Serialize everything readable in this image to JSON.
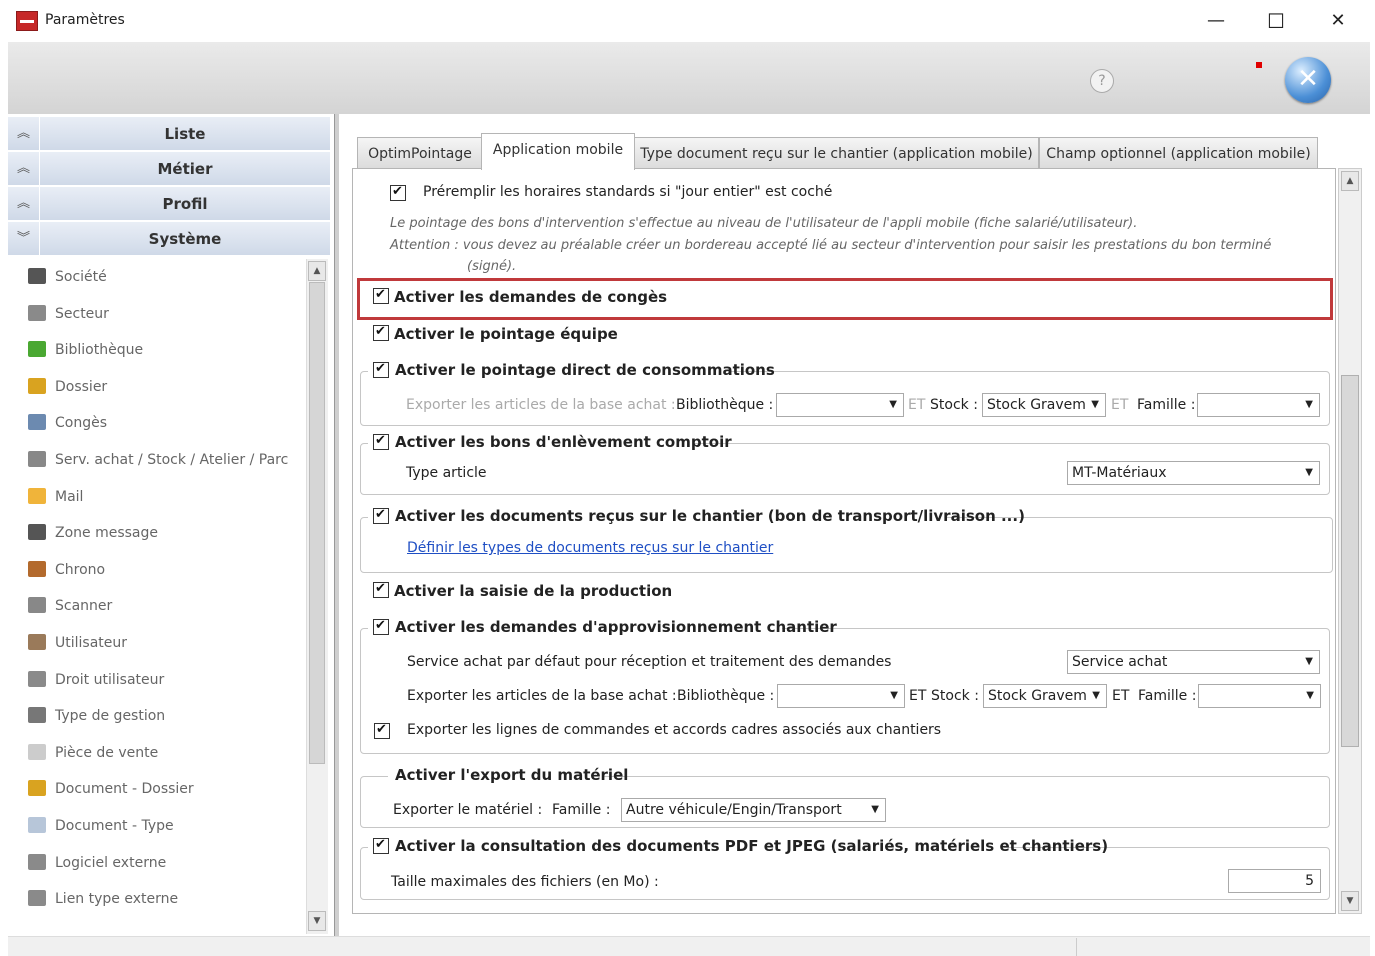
{
  "window": {
    "title": "Paramètres",
    "minimize": "—",
    "maximize": "☐",
    "close": "✕"
  },
  "toolbar": {
    "help_icon": "?",
    "close_icon": "✕"
  },
  "sidebar": {
    "sections": [
      {
        "label": "Liste",
        "chevron": "≈"
      },
      {
        "label": "Métier",
        "chevron": "≈"
      },
      {
        "label": "Profil",
        "chevron": "≈"
      },
      {
        "label": "Système",
        "chevron": "≈"
      }
    ],
    "items": [
      {
        "label": "Société",
        "icon": "building-icon",
        "color": "#555555"
      },
      {
        "label": "Secteur",
        "icon": "sector-icon",
        "color": "#8a8a8a"
      },
      {
        "label": "Bibliothèque",
        "icon": "library-icon",
        "color": "#4aa832"
      },
      {
        "label": "Dossier",
        "icon": "folder-icon",
        "color": "#d9a320"
      },
      {
        "label": "Congès",
        "icon": "calendar-icon",
        "color": "#6c8ab0"
      },
      {
        "label": "Serv. achat / Stock / Atelier / Parc",
        "icon": "truck-icon",
        "color": "#888888"
      },
      {
        "label": "Mail",
        "icon": "mail-icon",
        "color": "#f0b43a"
      },
      {
        "label": "Zone message",
        "icon": "message-icon",
        "color": "#555555"
      },
      {
        "label": "Chrono",
        "icon": "chrono-icon",
        "color": "#b36a2d"
      },
      {
        "label": "Scanner",
        "icon": "scanner-icon",
        "color": "#888888"
      },
      {
        "label": "Utilisateur",
        "icon": "user-icon",
        "color": "#9a7a5a"
      },
      {
        "label": "Droit utilisateur",
        "icon": "lock-icon",
        "color": "#8a8a8a"
      },
      {
        "label": "Type de gestion",
        "icon": "tag-icon",
        "color": "#777777"
      },
      {
        "label": "Pièce de vente",
        "icon": "coin-icon",
        "color": "#cccccc"
      },
      {
        "label": "Document - Dossier",
        "icon": "doc-folder-icon",
        "color": "#d9a320"
      },
      {
        "label": "Document - Type",
        "icon": "document-icon",
        "color": "#b7c6d9"
      },
      {
        "label": "Logiciel externe",
        "icon": "software-icon",
        "color": "#8a8a8a"
      },
      {
        "label": "Lien type externe",
        "icon": "link-icon",
        "color": "#8a8a8a"
      }
    ]
  },
  "tabs": [
    {
      "label": "OptimPointage"
    },
    {
      "label": "Application mobile"
    },
    {
      "label": "Type document reçu sur le chantier (application mobile)"
    },
    {
      "label": "Champ optionnel (application mobile)"
    }
  ],
  "settings": {
    "prefill_hours": "Préremplir les horaires standards si \"jour entier\" est coché",
    "note1": "Le pointage des bons d'intervention s'effectue au niveau de l'utilisateur de l'appli mobile (fiche salarié/utilisateur).",
    "note2": "Attention : vous devez au préalable créer un bordereau accepté lié au secteur d'intervention pour saisir les prestations du bon terminé",
    "note3": "(signé).",
    "leave_requests": "Activer les demandes de congès",
    "team_clocking": "Activer le pointage équipe",
    "direct_consumption": "Activer le pointage direct de consommations",
    "export_articles_grey": "Exporter les articles de la base achat :",
    "library_label": "Bibliothèque :",
    "et": "ET",
    "stock_label": "Stock :",
    "stock_value": "Stock Gravem",
    "family_label": "Famille :",
    "counter_removal": "Activer les bons d'enlèvement comptoir",
    "article_type_label": "Type article",
    "article_type_value": "MT-Matériaux",
    "site_documents": "Activer les documents reçus sur le chantier (bon de transport/livraison ...)",
    "define_doc_types_link": "Définir les types de documents reçus sur le chantier",
    "production_entry": "Activer la saisie de la production",
    "supply_requests": "Activer les demandes d'approvisionnement chantier",
    "default_purchase_service": "Service achat par défaut pour réception et traitement des demandes",
    "purchase_service_value": "Service achat",
    "export_articles": "Exporter les articles de la base achat :",
    "export_order_lines": "Exporter les lignes de commandes et accords cadres associés aux chantiers",
    "equipment_export": "Activer l'export du matériel",
    "export_equipment_label": "Exporter le matériel :",
    "equipment_family_value": "Autre véhicule/Engin/Transport",
    "pdf_consult": "Activer la consultation des documents PDF et JPEG (salariés, matériels et chantiers)",
    "max_file_size_label": "Taille maximales des fichiers (en Mo) :",
    "max_file_size_value": "5"
  }
}
